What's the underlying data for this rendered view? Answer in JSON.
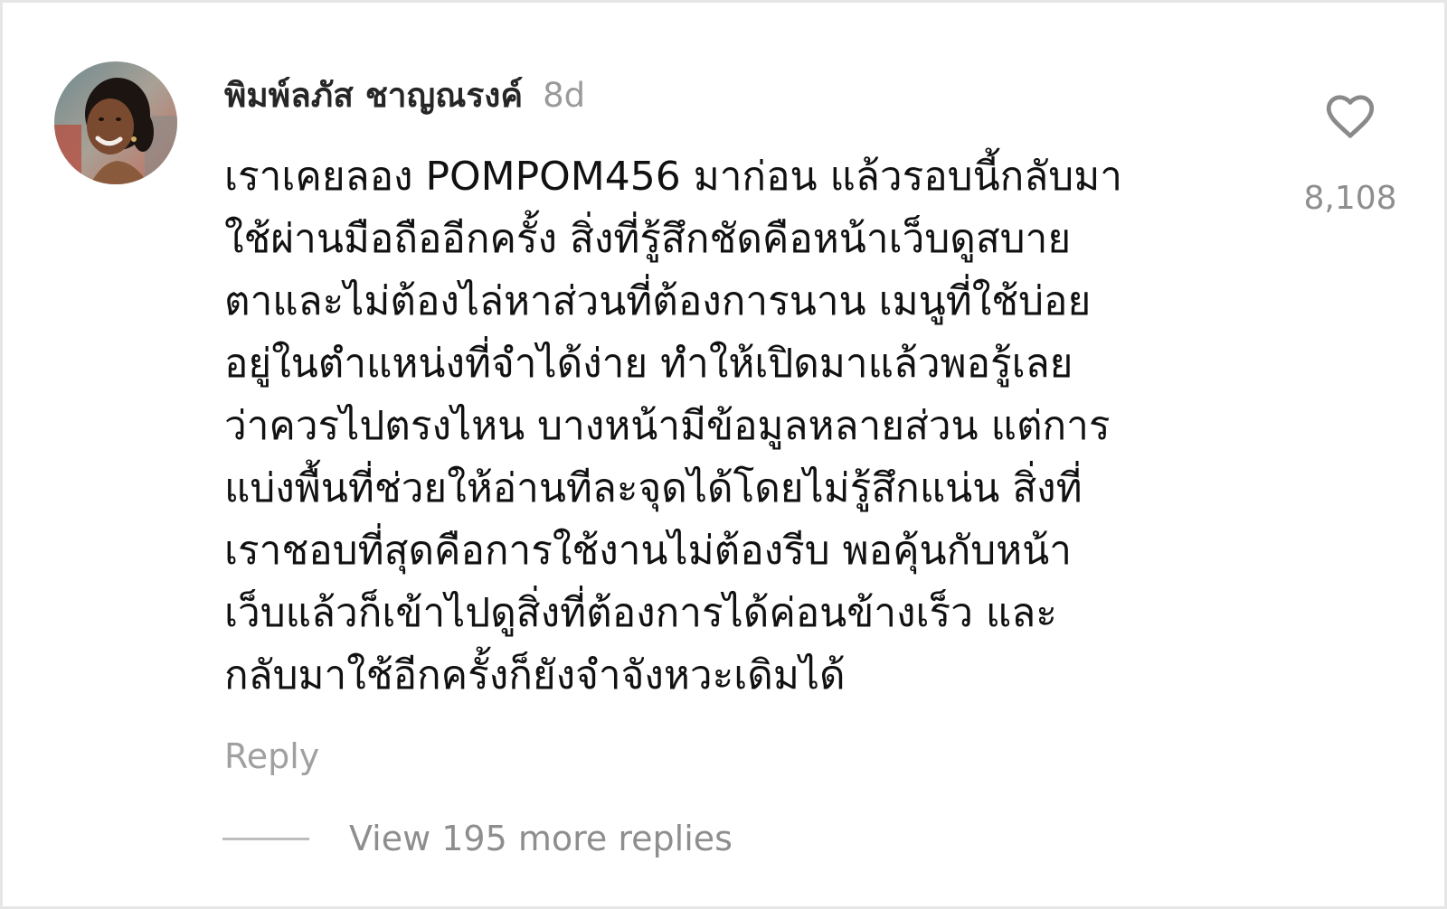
{
  "comment": {
    "username": "พิมพ์ลภัส ชาญณรงค์",
    "timestamp": "8d",
    "lines": [
      "เราเคยลอง POMPOM456 มาก่อน แล้วรอบนี้กลับมา",
      "ใช้ผ่านมือถืออีกครั้ง สิ่งที่รู้สึกชัดคือหน้าเว็บดูสบาย",
      "ตาและไม่ต้องไล่หาส่วนที่ต้องการนาน เมนูที่ใช้บ่อย",
      "อยู่ในตำแหน่งที่จำได้ง่าย ทำให้เปิดมาแล้วพอรู้เลย",
      "ว่าควรไปตรงไหน บางหน้ามีข้อมูลหลายส่วน แต่การ",
      "แบ่งพื้นที่ช่วยให้อ่านทีละจุดได้โดยไม่รู้สึกแน่น สิ่งที่",
      "เราชอบที่สุดคือการใช้งานไม่ต้องรีบ พอคุ้นกับหน้า",
      "เว็บแล้วก็เข้าไปดูสิ่งที่ต้องการได้ค่อนข้างเร็ว และ",
      "กลับมาใช้อีกครั้งก็ยังจำจังหวะเดิมได้"
    ],
    "like_count": "8,108",
    "reply_label": "Reply",
    "view_replies_label": "View 195 more replies"
  },
  "icons": {
    "like": "heart-outline-icon"
  },
  "colors": {
    "text_primary": "#111111",
    "text_secondary": "#8e8e8e",
    "border": "#e6e6e6"
  }
}
